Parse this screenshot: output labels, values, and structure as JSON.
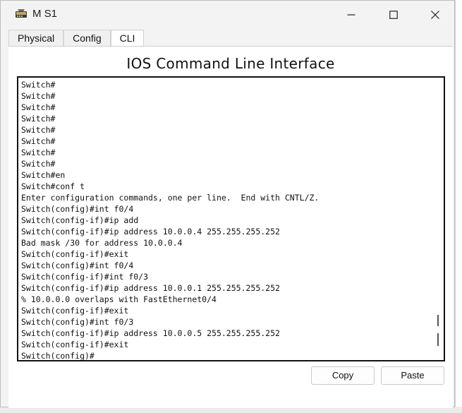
{
  "window": {
    "title": "M S1",
    "controls": [
      "minimize-icon",
      "maximize-icon",
      "close-icon"
    ]
  },
  "tabs": [
    {
      "label": "Physical",
      "active": false
    },
    {
      "label": "Config",
      "active": false
    },
    {
      "label": "CLI",
      "active": true
    }
  ],
  "cli": {
    "heading": "IOS Command Line Interface",
    "lines": [
      "Switch#",
      "Switch#",
      "Switch#",
      "Switch#",
      "Switch#",
      "Switch#",
      "Switch#",
      "Switch#",
      "Switch#en",
      "Switch#conf t",
      "Enter configuration commands, one per line.  End with CNTL/Z.",
      "Switch(config)#int f0/4",
      "Switch(config-if)#ip add",
      "Switch(config-if)#ip address 10.0.0.4 255.255.255.252",
      "Bad mask /30 for address 10.0.0.4",
      "Switch(config-if)#exit",
      "Switch(config)#int f0/4",
      "Switch(config-if)#int f0/3",
      "Switch(config-if)#ip address 10.0.0.1 255.255.255.252",
      "% 10.0.0.0 overlaps with FastEthernet0/4",
      "Switch(config-if)#exit",
      "Switch(config)#int f0/3",
      "Switch(config-if)#ip address 10.0.0.5 255.255.255.252",
      "Switch(config-if)#exit",
      "Switch(config)#"
    ]
  },
  "buttons": {
    "copy": "Copy",
    "paste": "Paste"
  },
  "colors": {
    "window_bg": "#f3f3f3",
    "terminal_border": "#111111",
    "text": "#111111"
  }
}
